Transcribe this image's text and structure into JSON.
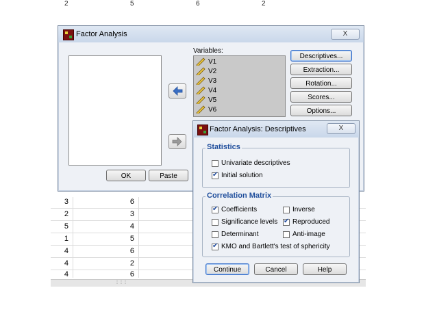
{
  "sheet": {
    "top_row": [
      "2",
      "5",
      "6",
      "2"
    ],
    "rows": [
      [
        "3",
        "6"
      ],
      [
        "2",
        "3"
      ],
      [
        "5",
        "4"
      ],
      [
        "1",
        "5"
      ],
      [
        "4",
        "6"
      ],
      [
        "4",
        "2"
      ],
      [
        "4",
        "6"
      ]
    ]
  },
  "fa_window": {
    "title": "Factor Analysis",
    "close_label": "X",
    "variables_label": "Variables:",
    "variables": [
      "V1",
      "V2",
      "V3",
      "V4",
      "V5",
      "V6"
    ],
    "side_buttons": {
      "descriptives": "Descriptives...",
      "extraction": "Extraction...",
      "rotation": "Rotation...",
      "scores": "Scores...",
      "options": "Options..."
    },
    "ok_label": "OK",
    "paste_label": "Paste"
  },
  "desc_window": {
    "title": "Factor Analysis: Descriptives",
    "close_label": "X",
    "statistics_title": "Statistics",
    "statistics": [
      {
        "label": "Univariate descriptives",
        "checked": false
      },
      {
        "label": "Initial solution",
        "checked": true
      }
    ],
    "correlation_title": "Correlation Matrix",
    "correlation_left": [
      {
        "label": "Coefficients",
        "checked": true
      },
      {
        "label": "Significance levels",
        "checked": false
      },
      {
        "label": "Determinant",
        "checked": false
      },
      {
        "label": "KMO and Bartlett's test of sphericity",
        "checked": true
      }
    ],
    "correlation_right": [
      {
        "label": "Inverse",
        "checked": false
      },
      {
        "label": "Reproduced",
        "checked": true
      },
      {
        "label": "Anti-image",
        "checked": false
      }
    ],
    "continue_label": "Continue",
    "cancel_label": "Cancel",
    "help_label": "Help"
  },
  "colors": {
    "group_title": "#1f4e9c",
    "variables_bg": "#c9c9c9",
    "dialog_bg": "#eef1f6"
  }
}
